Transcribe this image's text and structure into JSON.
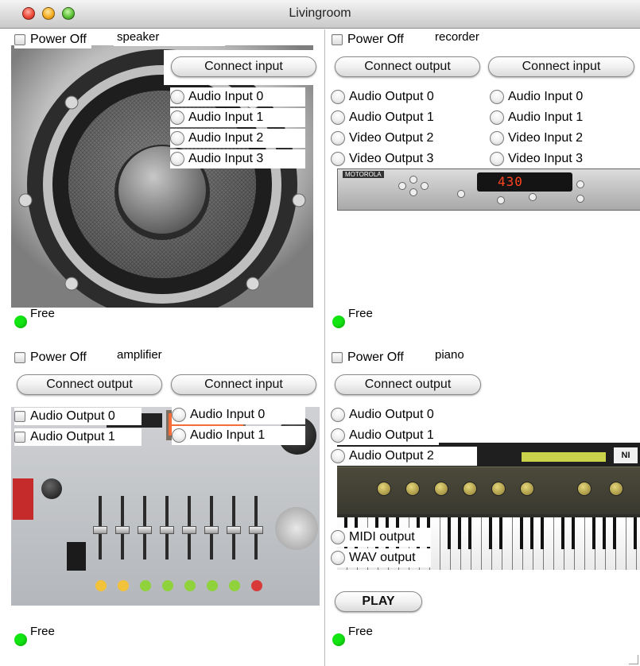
{
  "window": {
    "title": "Livingroom"
  },
  "colors": {
    "status_free": "#12e612"
  },
  "panels": {
    "speaker": {
      "name": "speaker",
      "power_label": "Power Off",
      "connect_input_label": "Connect input",
      "inputs": [
        "Audio Input 0",
        "Audio Input 1",
        "Audio Input 2",
        "Audio Input 3"
      ],
      "status": "Free"
    },
    "recorder": {
      "name": "recorder",
      "power_label": "Power Off",
      "connect_output_label": "Connect output",
      "connect_input_label": "Connect input",
      "outputs": [
        "Audio Output 0",
        "Audio Output 1",
        "Video Output 2",
        "Video Output 3"
      ],
      "inputs": [
        "Audio Input 0",
        "Audio Input 1",
        "Video Input 2",
        "Video Input 3"
      ],
      "display": "430",
      "brand": "MOTOROLA",
      "status": "Free"
    },
    "amplifier": {
      "name": "amplifier",
      "power_label": "Power Off",
      "connect_output_label": "Connect output",
      "connect_input_label": "Connect input",
      "outputs": [
        "Audio Output 0",
        "Audio Output 1"
      ],
      "inputs": [
        "Audio Input 0",
        "Audio Input 1"
      ],
      "status": "Free"
    },
    "piano": {
      "name": "piano",
      "power_label": "Power Off",
      "connect_output_label": "Connect output",
      "outputs": [
        "Audio Output 0",
        "Audio Output 1",
        "Audio Output 2",
        "MIDI output",
        "WAV output"
      ],
      "play_label": "PLAY",
      "synth_badge": "NI",
      "status": "Free"
    }
  }
}
